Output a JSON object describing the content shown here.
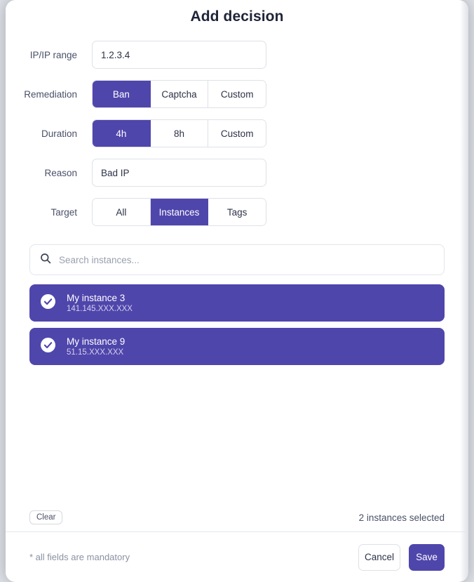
{
  "dialog": {
    "title": "Add decision",
    "fields": {
      "ip": {
        "label": "IP/IP range",
        "value": "1.2.3.4"
      },
      "remediation": {
        "label": "Remediation"
      },
      "duration": {
        "label": "Duration"
      },
      "reason": {
        "label": "Reason",
        "value": "Bad IP"
      },
      "target": {
        "label": "Target"
      }
    },
    "remediation_options": [
      {
        "label": "Ban",
        "selected": true
      },
      {
        "label": "Captcha",
        "selected": false
      },
      {
        "label": "Custom",
        "selected": false
      }
    ],
    "duration_options": [
      {
        "label": "4h",
        "selected": true
      },
      {
        "label": "8h",
        "selected": false
      },
      {
        "label": "Custom",
        "selected": false
      }
    ],
    "target_options": [
      {
        "label": "All",
        "selected": false
      },
      {
        "label": "Instances",
        "selected": true
      },
      {
        "label": "Tags",
        "selected": false
      }
    ],
    "search": {
      "placeholder": "Search instances...",
      "value": "",
      "icon": "search-icon"
    },
    "instances": [
      {
        "name": "My instance 3",
        "ip": "141.145.XXX.XXX",
        "selected": true,
        "icon": "check-circle-icon"
      },
      {
        "name": "My instance 9",
        "ip": "51.15.XXX.XXX",
        "selected": true,
        "icon": "check-circle-icon"
      }
    ],
    "selection_bar": {
      "clear_label": "Clear",
      "count_label": "2 instances selected"
    },
    "footer": {
      "mandatory_note": "* all fields are mandatory",
      "cancel_label": "Cancel",
      "save_label": "Save"
    },
    "colors": {
      "accent": "#4f46ac",
      "text": "#2c3247",
      "muted": "#8b91a2",
      "border": "#dfe1e8",
      "page_bg": "#dfe2e6"
    }
  }
}
